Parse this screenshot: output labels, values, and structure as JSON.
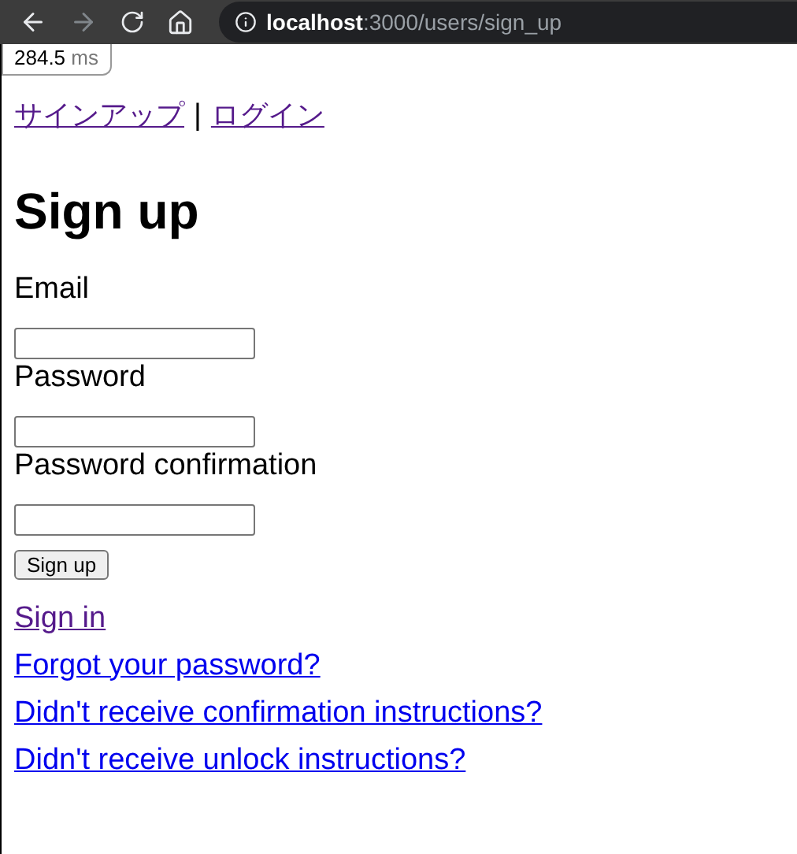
{
  "browser": {
    "url_host": "localhost",
    "url_rest": ":3000/users/sign_up",
    "back_enabled": true,
    "forward_enabled": false
  },
  "profiler": {
    "value": "284.5",
    "unit": "ms"
  },
  "nav": {
    "links": [
      {
        "label": "サインアップ",
        "visited": true
      },
      {
        "label": "ログイン",
        "visited": true
      }
    ],
    "separator": "|"
  },
  "heading": "Sign up",
  "fields": [
    {
      "label": "Email"
    },
    {
      "label": "Password"
    },
    {
      "label": "Password confirmation"
    }
  ],
  "submit": "Sign up",
  "links": [
    {
      "label": "Sign in",
      "visited": true
    },
    {
      "label": "Forgot your password?",
      "visited": false
    },
    {
      "label": "Didn't receive confirmation instructions?",
      "visited": false
    },
    {
      "label": "Didn't receive unlock instructions?",
      "visited": false
    }
  ]
}
